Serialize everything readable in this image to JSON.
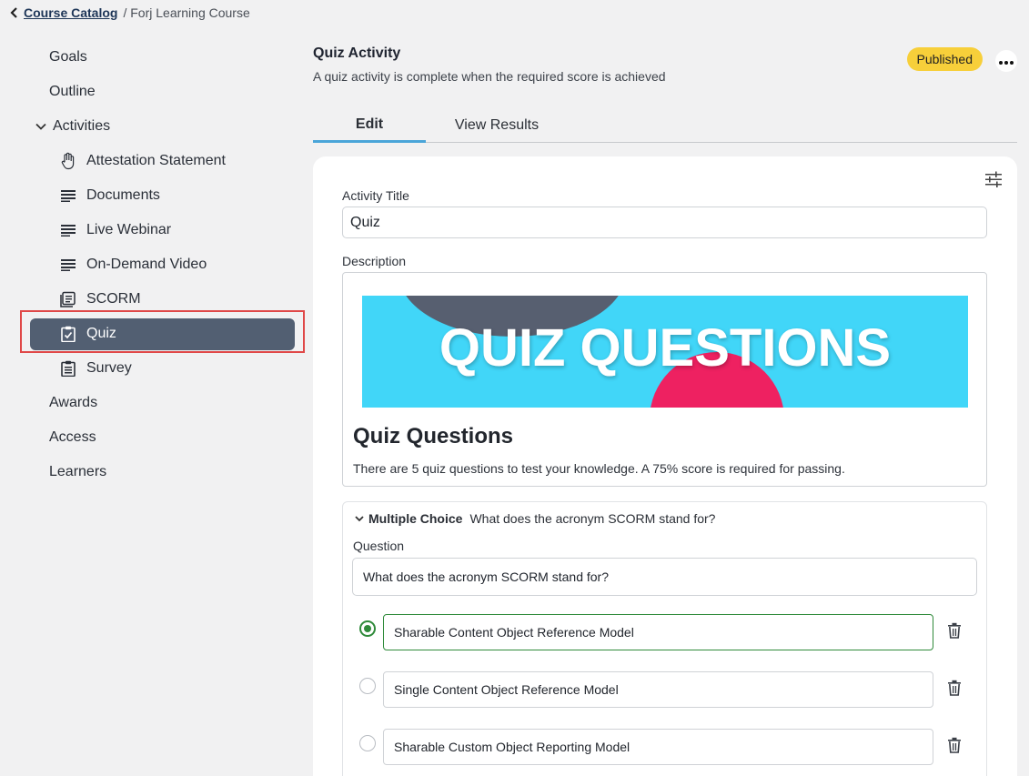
{
  "breadcrumb": {
    "catalog_link": "Course Catalog",
    "current": "/ Forj Learning Course"
  },
  "sidebar": {
    "top_items": [
      "Goals",
      "Outline"
    ],
    "section_label": "Activities",
    "activities": [
      {
        "label": "Attestation Statement",
        "icon": "hand-icon"
      },
      {
        "label": "Documents",
        "icon": "lines-icon"
      },
      {
        "label": "Live Webinar",
        "icon": "lines-icon"
      },
      {
        "label": "On-Demand Video",
        "icon": "lines-icon"
      },
      {
        "label": "SCORM",
        "icon": "scorm-icon"
      },
      {
        "label": "Quiz",
        "icon": "clipboard-check-icon",
        "active": true
      },
      {
        "label": "Survey",
        "icon": "clipboard-list-icon"
      }
    ],
    "bottom_items": [
      "Awards",
      "Access",
      "Learners"
    ]
  },
  "header": {
    "title": "Quiz Activity",
    "subtitle": "A quiz activity is complete when the required score is achieved",
    "status_badge": "Published"
  },
  "tabs": [
    "Edit",
    "View Results"
  ],
  "form": {
    "activity_title_label": "Activity Title",
    "activity_title_value": "Quiz",
    "description_label": "Description",
    "banner_text": "QUIZ QUESTIONS",
    "description_title": "Quiz Questions",
    "description_text": "There are 5 quiz questions to test your knowledge. A 75% score is required for passing."
  },
  "question": {
    "type": "Multiple Choice",
    "summary": "What does the acronym SCORM stand for?",
    "question_label": "Question",
    "question_value": "What does the acronym SCORM stand for?",
    "answers": [
      {
        "text": "Sharable Content Object Reference Model",
        "correct": true
      },
      {
        "text": "Single Content Object Reference Model",
        "correct": false
      },
      {
        "text": "Sharable Custom Object Reporting Model",
        "correct": false
      }
    ]
  },
  "colors": {
    "active_nav": "#525f72",
    "badge": "#f7cf3a",
    "tab_accent": "#4aa5d9",
    "correct": "#2f8a3a",
    "highlight_outline": "#e04848"
  }
}
